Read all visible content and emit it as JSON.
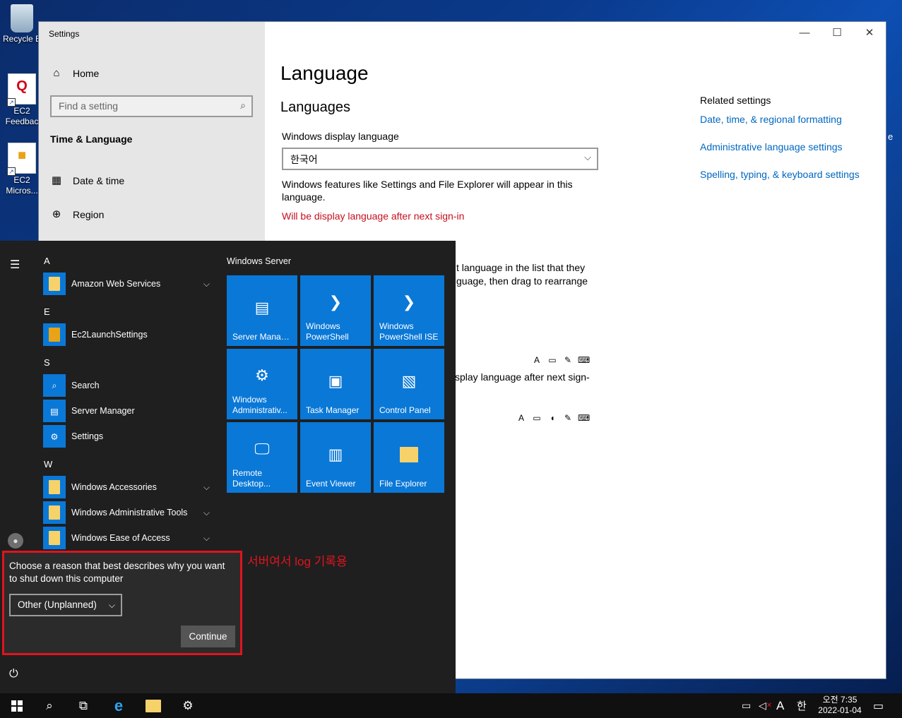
{
  "desktop": {
    "icons": [
      {
        "label": "Recycle B"
      },
      {
        "label": "EC2 Feedbac",
        "glyph": "Q"
      },
      {
        "label": "EC2 Micros..."
      }
    ]
  },
  "settings": {
    "window_title": "Settings",
    "controls": {
      "minimize": "—",
      "maximize": "☐",
      "close": "✕"
    },
    "nav": {
      "home": "Home",
      "search_placeholder": "Find a setting",
      "section": "Time & Language",
      "items": [
        "Date & time",
        "Region"
      ]
    },
    "page_title": "Language",
    "languages_heading": "Languages",
    "display_language_label": "Windows display language",
    "display_language_value": "한국어",
    "display_language_desc": "Windows features like Settings and File Explorer will appear in this language.",
    "display_language_warning": "Will be display language after next sign-in",
    "partial_text_1": "t language in the list that they",
    "partial_text_2": "guage, then drag to rearrange",
    "partial_text_3": "splay language after next sign-",
    "edge_glyph": "e",
    "related": {
      "heading": "Related settings",
      "links": [
        "Date, time, & regional formatting",
        "Administrative language settings",
        "Spelling, typing, & keyboard settings"
      ]
    }
  },
  "start_menu": {
    "groups": [
      {
        "letter": "A",
        "apps": [
          {
            "name": "Amazon Web Services",
            "expandable": true
          }
        ]
      },
      {
        "letter": "E",
        "apps": [
          {
            "name": "Ec2LaunchSettings",
            "expandable": false
          }
        ]
      },
      {
        "letter": "S",
        "apps": [
          {
            "name": "Search",
            "expandable": false
          },
          {
            "name": "Server Manager",
            "expandable": false
          },
          {
            "name": "Settings",
            "expandable": false
          }
        ]
      },
      {
        "letter": "W",
        "apps": [
          {
            "name": "Windows Accessories",
            "expandable": true
          },
          {
            "name": "Windows Administrative Tools",
            "expandable": true
          },
          {
            "name": "Windows Ease of Access",
            "expandable": true
          }
        ]
      }
    ],
    "tile_group_title": "Windows Server",
    "tiles": [
      {
        "label": "Server Manager"
      },
      {
        "label": "Windows PowerShell"
      },
      {
        "label": "Windows PowerShell ISE"
      },
      {
        "label": "Windows Administrativ..."
      },
      {
        "label": "Task Manager"
      },
      {
        "label": "Control Panel"
      },
      {
        "label": "Remote Desktop..."
      },
      {
        "label": "Event Viewer"
      },
      {
        "label": "File Explorer"
      }
    ]
  },
  "shutdown_reason": {
    "question": "Choose a reason that best describes why you want to shut down this computer",
    "selected": "Other (Unplanned)",
    "continue_label": "Continue"
  },
  "annotation": "서버여서 log 기록용",
  "taskbar": {
    "ime_letter": "A",
    "ime_lang": "한",
    "time": "오전 7:35",
    "date": "2022-01-04"
  },
  "colors": {
    "accent": "#0a78d7",
    "link": "#0067c0",
    "warning": "#c50f1f",
    "highlight": "#e0141e"
  }
}
